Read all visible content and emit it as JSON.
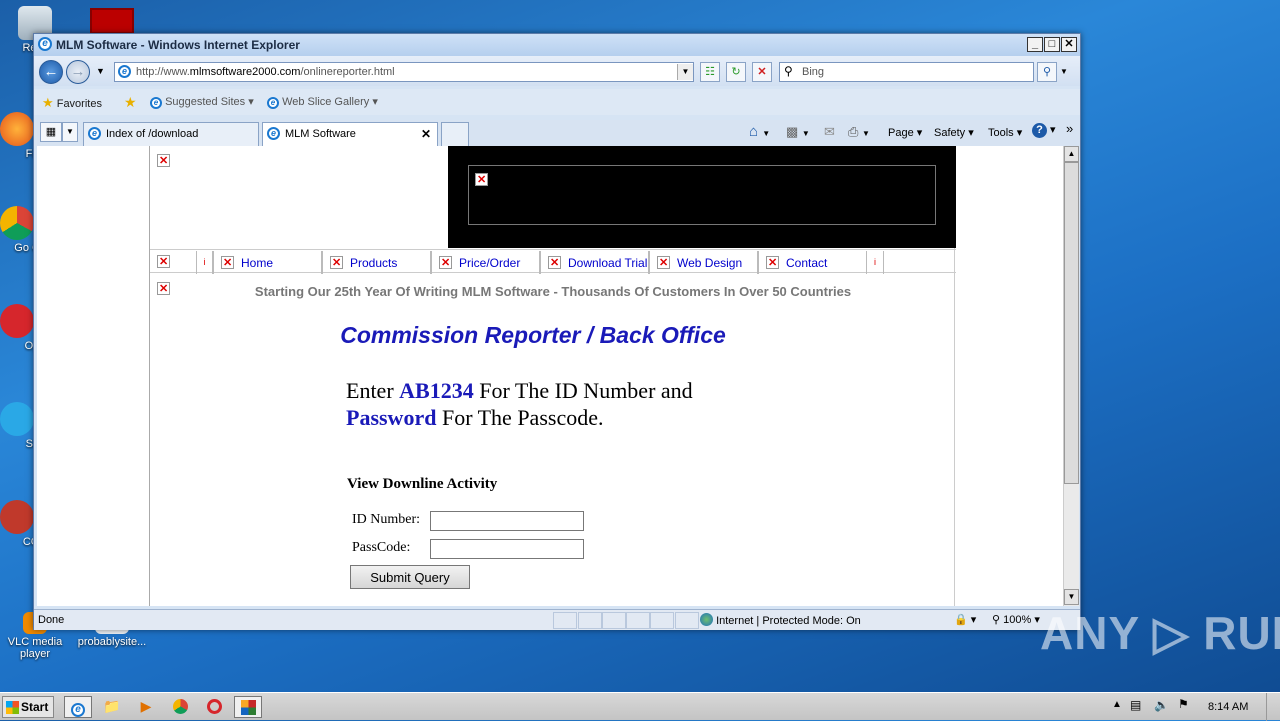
{
  "window": {
    "title": "MLM Software - Windows Internet Explorer",
    "minimize": "_",
    "maximize": "□",
    "close": "✕"
  },
  "nav": {
    "url_prefix": "http://www.",
    "url_host": "mlmsoftware2000.com",
    "url_path": "/onlinereporter.html",
    "search_placeholder": "Bing"
  },
  "favorites": {
    "label": "Favorites",
    "suggested": "Suggested Sites",
    "webslice": "Web Slice Gallery"
  },
  "tabs": [
    {
      "label": "Index of /download",
      "active": false
    },
    {
      "label": "MLM Software",
      "active": true
    }
  ],
  "commands": {
    "page": "Page",
    "safety": "Safety",
    "tools": "Tools"
  },
  "page": {
    "menu": [
      "Home",
      "Products",
      "Price/Order",
      "Download Trial",
      "Web Design",
      "Contact"
    ],
    "tagline": "Starting Our 25th Year Of Writing MLM Software - Thousands Of Customers In Over 50 Countries",
    "heading": "Commission Reporter / Back Office",
    "instr_enter": "Enter ",
    "instr_id": "AB1234",
    "instr_id_rest": " For The ID Number and",
    "instr_pass": "Password",
    "instr_pass_rest": " For The Passcode.",
    "form_title": "View Downline Activity",
    "id_label": "ID Number:",
    "id_value": "",
    "pass_label": "PassCode:",
    "pass_value": "",
    "submit": "Submit Query"
  },
  "status": {
    "text": "Done",
    "zone": "Internet | Protected Mode: On",
    "zoom": "100%"
  },
  "desktop": {
    "icons": [
      "Recy",
      "Fir",
      "Go Chr",
      "Op",
      "Sk",
      "CCl"
    ],
    "vlc": "VLC media player",
    "probably": "probablysite..."
  },
  "taskbar": {
    "start": "Start",
    "clock": "8:14 AM"
  },
  "watermark": "ANY ▷ RUN",
  "colors": {
    "link_blue": "#1a1ab8",
    "menu_link": "#0000cc",
    "tagline_grey": "#777777"
  }
}
